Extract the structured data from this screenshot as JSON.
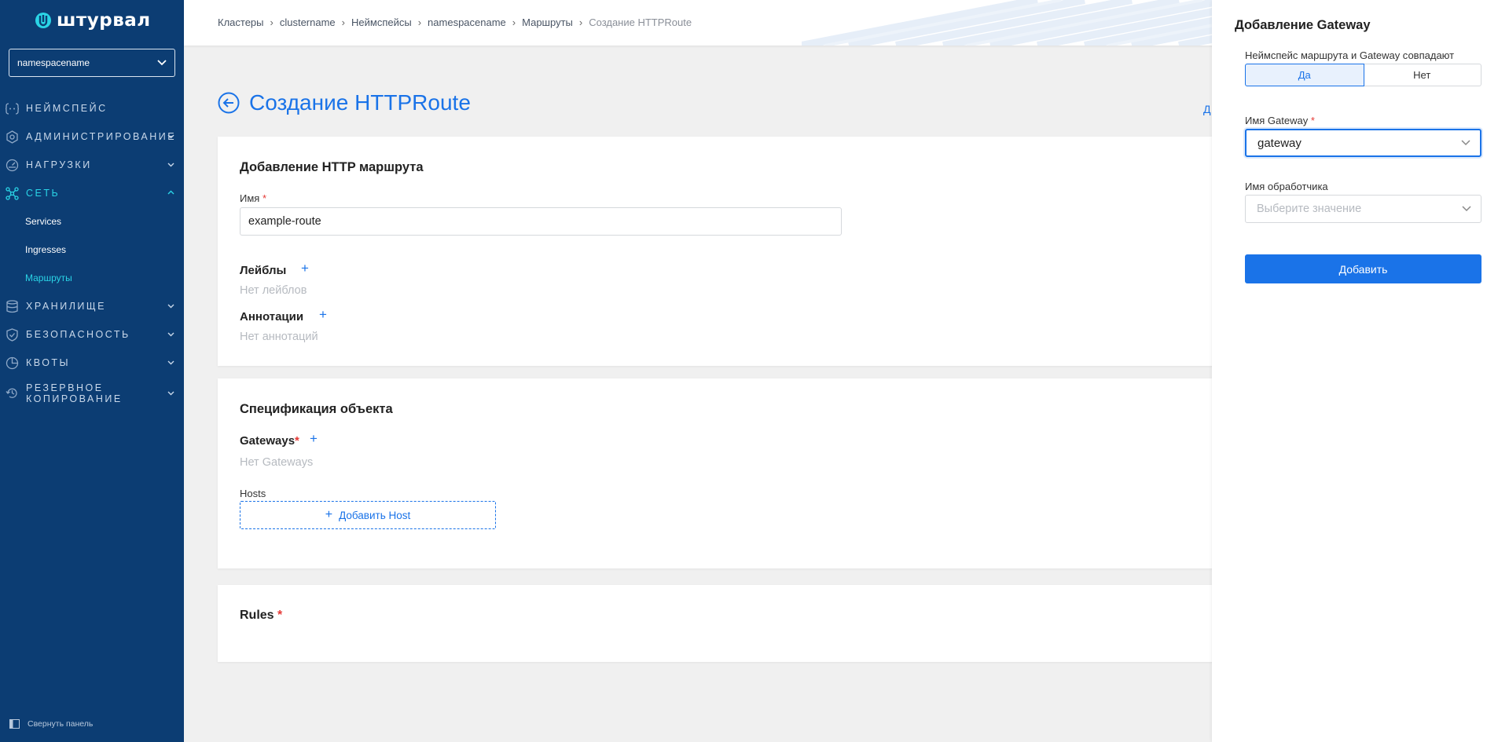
{
  "app": {
    "logo_text": "штурвал"
  },
  "sidebar": {
    "namespace_select": "namespacename",
    "items": [
      {
        "label": "НЕЙМСПЕЙС"
      },
      {
        "label": "АДМИНИСТРИРОВАНИЕ"
      },
      {
        "label": "НАГРУЗКИ"
      },
      {
        "label": "СЕТЬ"
      },
      {
        "label": "ХРАНИЛИЩЕ"
      },
      {
        "label": "БЕЗОПАСНОСТЬ"
      },
      {
        "label": "КВОТЫ"
      },
      {
        "label": "РЕЗЕРВНОЕ КОПИРОВАНИЕ",
        "line1": "РЕЗЕРВНОЕ",
        "line2": "КОПИРОВАНИЕ"
      }
    ],
    "sub_items": [
      {
        "label": "Services"
      },
      {
        "label": "Ingresses"
      },
      {
        "label": "Маршруты"
      }
    ],
    "collapse_label": "Свернуть панель"
  },
  "breadcrumb": [
    "Кластеры",
    "clustername",
    "Неймспейсы",
    "namespacename",
    "Маршруты",
    "Создание HTTPRoute"
  ],
  "page": {
    "title": "Создание HTTPRoute",
    "right_link": "Д"
  },
  "card1": {
    "title": "Добавление HTTP маршрута",
    "name_label": "Имя",
    "name_value": "example-route",
    "labels_title": "Лейблы",
    "labels_empty": "Нет лейблов",
    "annotations_title": "Аннотации",
    "annotations_empty": "Нет аннотаций"
  },
  "card2": {
    "title": "Спецификация объекта",
    "gateways_title": "Gateways",
    "gateways_empty": "Нет Gateways",
    "hosts_label": "Hosts",
    "add_host": "Добавить Host"
  },
  "card3": {
    "title": "Rules"
  },
  "drawer": {
    "title": "Добавление Gateway",
    "ns_match_label": "Неймспейс маршрута и Gateway совпадают",
    "yes": "Да",
    "no": "Нет",
    "selected": "Да",
    "gateway_name_label": "Имя Gateway",
    "gateway_name_value": "gateway",
    "handler_label": "Имя обработчика",
    "handler_placeholder": "Выберите значение",
    "submit": "Добавить"
  },
  "colors": {
    "sidebar_bg": "#0c3d73",
    "accent": "#1a73e8",
    "active_nav": "#2ad4e6"
  }
}
